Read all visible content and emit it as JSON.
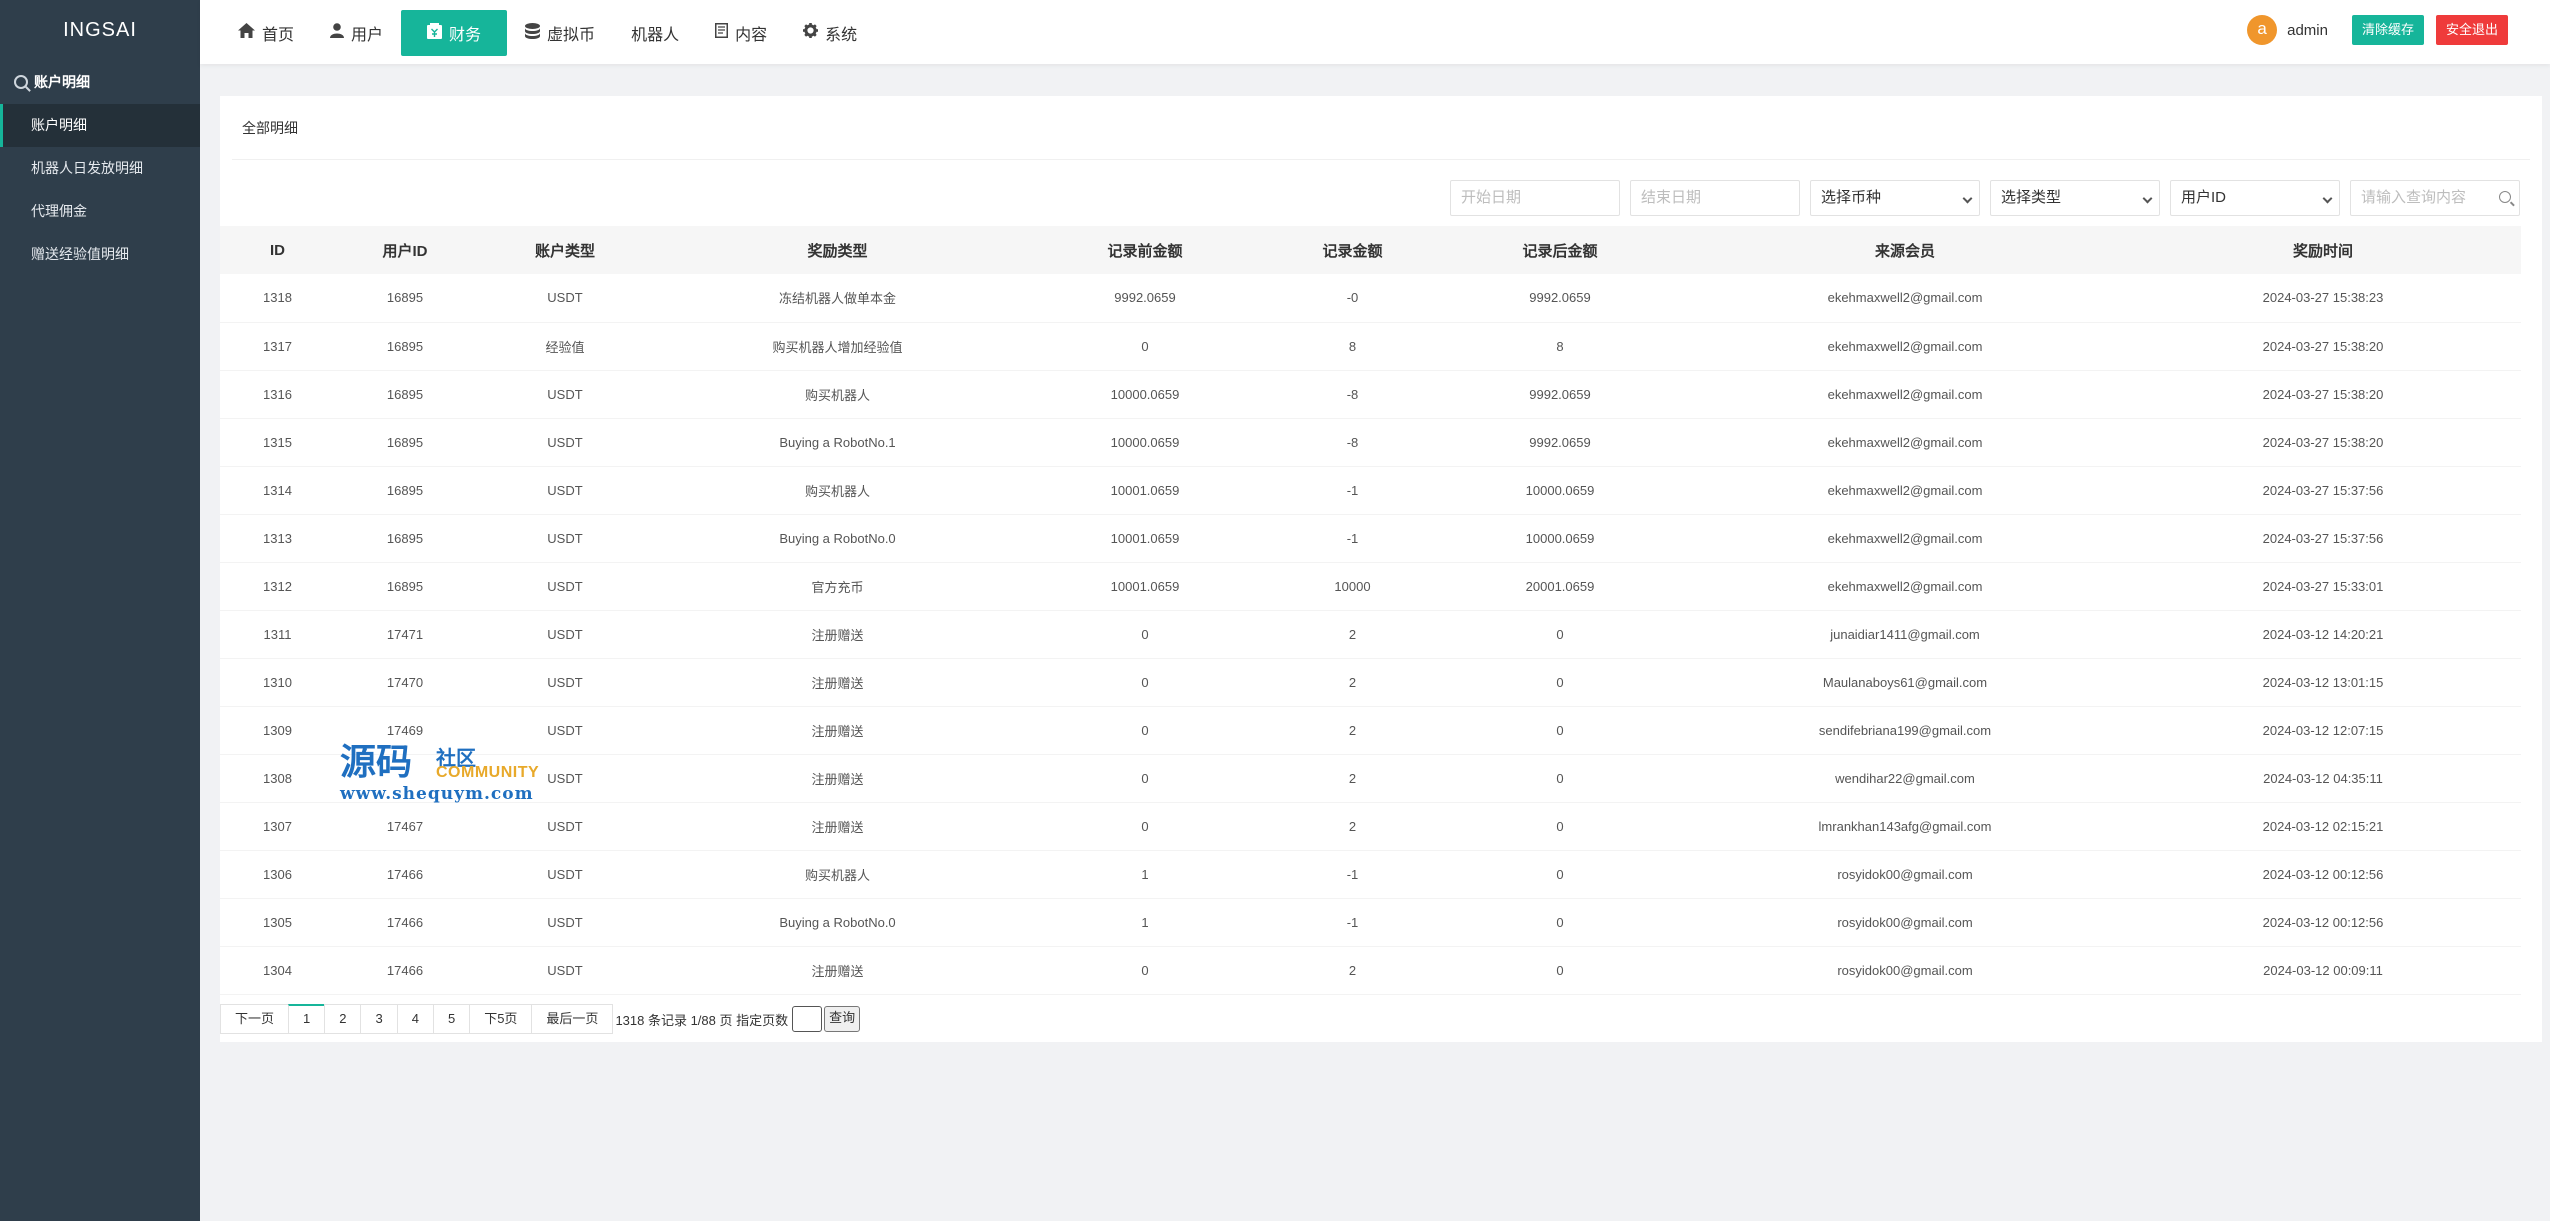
{
  "brand": "INGSAI",
  "sidebar": {
    "group": "账户明细",
    "items": [
      {
        "label": "账户明细"
      },
      {
        "label": "机器人日发放明细"
      },
      {
        "label": "代理佣金"
      },
      {
        "label": "赠送经验值明细"
      }
    ]
  },
  "nav": [
    {
      "label": "首页",
      "icon": "home-icon"
    },
    {
      "label": "用户",
      "icon": "user-icon"
    },
    {
      "label": "财务",
      "icon": "finance-icon"
    },
    {
      "label": "虚拟币",
      "icon": "database-icon"
    },
    {
      "label": "机器人",
      "icon": ""
    },
    {
      "label": "内容",
      "icon": "document-icon"
    },
    {
      "label": "系统",
      "icon": "gear-icon"
    }
  ],
  "header": {
    "avatar_letter": "a",
    "username": "admin",
    "clear_cache": "清除缓存",
    "logout": "安全退出"
  },
  "panel": {
    "title": "全部明细"
  },
  "filters": {
    "start_date": "开始日期",
    "end_date": "结束日期",
    "currency": "选择币种",
    "type": "选择类型",
    "user_field": "用户ID",
    "search_placeholder": "请输入查询内容"
  },
  "table": {
    "columns": [
      "ID",
      "用户ID",
      "账户类型",
      "奖励类型",
      "记录前金额",
      "记录金额",
      "记录后金额",
      "来源会员",
      "奖励时间"
    ],
    "rows": [
      [
        "1318",
        "16895",
        "USDT",
        "冻结机器人做单本金",
        "9992.0659",
        "-0",
        "9992.0659",
        "ekehmaxwell2@gmail.com",
        "2024-03-27 15:38:23"
      ],
      [
        "1317",
        "16895",
        "经验值",
        "购买机器人增加经验值",
        "0",
        "8",
        "8",
        "ekehmaxwell2@gmail.com",
        "2024-03-27 15:38:20"
      ],
      [
        "1316",
        "16895",
        "USDT",
        "购买机器人",
        "10000.0659",
        "-8",
        "9992.0659",
        "ekehmaxwell2@gmail.com",
        "2024-03-27 15:38:20"
      ],
      [
        "1315",
        "16895",
        "USDT",
        "Buying a RobotNo.1",
        "10000.0659",
        "-8",
        "9992.0659",
        "ekehmaxwell2@gmail.com",
        "2024-03-27 15:38:20"
      ],
      [
        "1314",
        "16895",
        "USDT",
        "购买机器人",
        "10001.0659",
        "-1",
        "10000.0659",
        "ekehmaxwell2@gmail.com",
        "2024-03-27 15:37:56"
      ],
      [
        "1313",
        "16895",
        "USDT",
        "Buying a RobotNo.0",
        "10001.0659",
        "-1",
        "10000.0659",
        "ekehmaxwell2@gmail.com",
        "2024-03-27 15:37:56"
      ],
      [
        "1312",
        "16895",
        "USDT",
        "官方充币",
        "10001.0659",
        "10000",
        "20001.0659",
        "ekehmaxwell2@gmail.com",
        "2024-03-27 15:33:01"
      ],
      [
        "1311",
        "17471",
        "USDT",
        "注册赠送",
        "0",
        "2",
        "0",
        "junaidiar1411@gmail.com",
        "2024-03-12 14:20:21"
      ],
      [
        "1310",
        "17470",
        "USDT",
        "注册赠送",
        "0",
        "2",
        "0",
        "Maulanaboys61@gmail.com",
        "2024-03-12 13:01:15"
      ],
      [
        "1309",
        "17469",
        "USDT",
        "注册赠送",
        "0",
        "2",
        "0",
        "sendifebriana199@gmail.com",
        "2024-03-12 12:07:15"
      ],
      [
        "1308",
        "",
        "USDT",
        "注册赠送",
        "0",
        "2",
        "0",
        "wendihar22@gmail.com",
        "2024-03-12 04:35:11"
      ],
      [
        "1307",
        "17467",
        "USDT",
        "注册赠送",
        "0",
        "2",
        "0",
        "lmrankhan143afg@gmail.com",
        "2024-03-12 02:15:21"
      ],
      [
        "1306",
        "17466",
        "USDT",
        "购买机器人",
        "1",
        "-1",
        "0",
        "rosyidok00@gmail.com",
        "2024-03-12 00:12:56"
      ],
      [
        "1305",
        "17466",
        "USDT",
        "Buying a RobotNo.0",
        "1",
        "-1",
        "0",
        "rosyidok00@gmail.com",
        "2024-03-12 00:12:56"
      ],
      [
        "1304",
        "17466",
        "USDT",
        "注册赠送",
        "0",
        "2",
        "0",
        "rosyidok00@gmail.com",
        "2024-03-12 00:09:11"
      ]
    ]
  },
  "pager": {
    "prev": "下一页",
    "pages": [
      "1",
      "2",
      "3",
      "4",
      "5"
    ],
    "next5": "下5页",
    "last": "最后一页",
    "info": "1318 条记录 1/88 页 指定页数",
    "go": "查询"
  },
  "watermark": {
    "main": "源码",
    "side": "社区",
    "community": "COMMUNITY",
    "url": "www.shequym.com"
  },
  "colors": {
    "sidebar": "#2f3e4b",
    "accent": "#16b59a",
    "danger": "#ef3b3b",
    "avatar": "#f0962c"
  }
}
